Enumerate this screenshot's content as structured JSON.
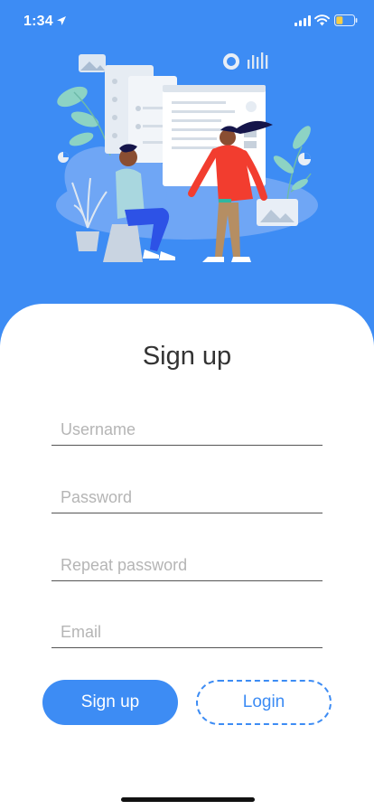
{
  "status_bar": {
    "time": "1:34"
  },
  "hero": {
    "image": "team-collaboration-illustration"
  },
  "form": {
    "title": "Sign up",
    "username_placeholder": "Username",
    "password_placeholder": "Password",
    "repeat_password_placeholder": "Repeat password",
    "email_placeholder": "Email",
    "signup_label": "Sign up",
    "login_label": "Login"
  },
  "colors": {
    "primary": "#3D8CF4",
    "background": "#FFFFFF",
    "text": "#333333"
  }
}
